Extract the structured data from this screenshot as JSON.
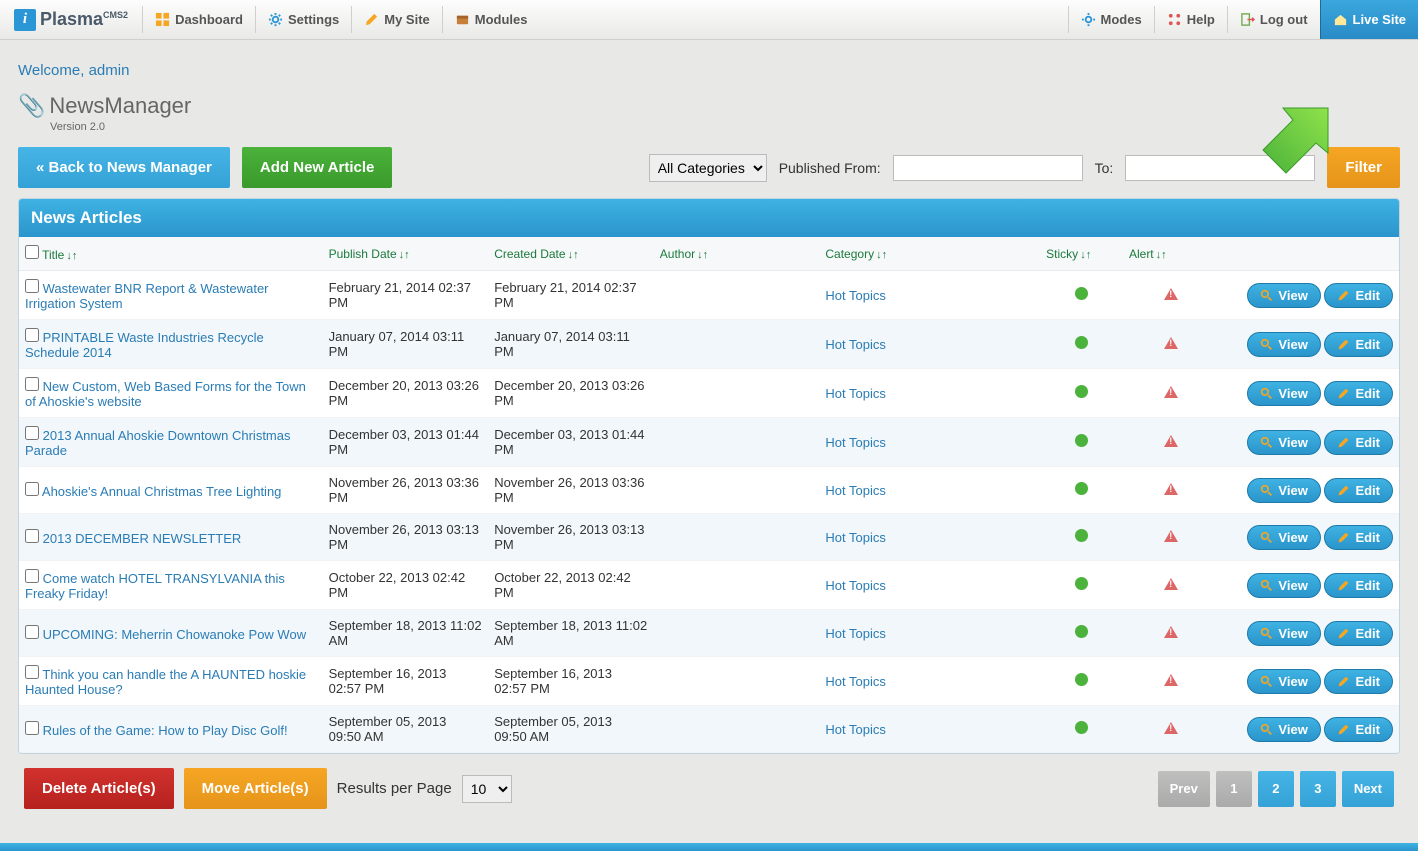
{
  "topnav": {
    "brand_i": "i",
    "brand": "Plasma",
    "brand_suffix": "CMS2",
    "items": [
      "Dashboard",
      "Settings",
      "My Site",
      "Modules"
    ],
    "right": [
      "Modes",
      "Help",
      "Log out",
      "Live Site"
    ]
  },
  "welcome": "Welcome, admin",
  "module": {
    "name": "NewsManager",
    "version": "Version 2.0"
  },
  "buttons": {
    "back": "« Back to News Manager",
    "add": "Add New Article",
    "filter": "Filter",
    "delete": "Delete Article(s)",
    "move": "Move Article(s)"
  },
  "filter": {
    "category_sel": "All Categories",
    "from_lbl": "Published From:",
    "to_lbl": "To:"
  },
  "panel_title": "News Articles",
  "columns": [
    "Title",
    "Publish Date",
    "Created Date",
    "Author",
    "Category",
    "Sticky",
    "Alert"
  ],
  "rows": [
    {
      "title": "Wastewater BNR Report & Wastewater Irrigation System",
      "pub": "February 21, 2014 02:37 PM",
      "crt": "February 21, 2014 02:37 PM",
      "cat": "Hot Topics"
    },
    {
      "title": "PRINTABLE Waste Industries Recycle Schedule 2014",
      "pub": "January 07, 2014 03:11 PM",
      "crt": "January 07, 2014 03:11 PM",
      "cat": "Hot Topics"
    },
    {
      "title": "New Custom, Web Based Forms for the Town of Ahoskie's website",
      "pub": "December 20, 2013 03:26 PM",
      "crt": "December 20, 2013 03:26 PM",
      "cat": "Hot Topics"
    },
    {
      "title": "2013 Annual Ahoskie Downtown Christmas Parade",
      "pub": "December 03, 2013 01:44 PM",
      "crt": "December 03, 2013 01:44 PM",
      "cat": "Hot Topics"
    },
    {
      "title": "Ahoskie's Annual Christmas Tree Lighting",
      "pub": "November 26, 2013 03:36 PM",
      "crt": "November 26, 2013 03:36 PM",
      "cat": "Hot Topics"
    },
    {
      "title": "2013 DECEMBER NEWSLETTER",
      "pub": "November 26, 2013 03:13 PM",
      "crt": "November 26, 2013 03:13 PM",
      "cat": "Hot Topics"
    },
    {
      "title": "Come watch HOTEL TRANSYLVANIA this Freaky Friday!",
      "pub": "October 22, 2013 02:42 PM",
      "crt": "October 22, 2013 02:42 PM",
      "cat": "Hot Topics"
    },
    {
      "title": "UPCOMING: Meherrin Chowanoke Pow Wow",
      "pub": "September 18, 2013 11:02 AM",
      "crt": "September 18, 2013 11:02 AM",
      "cat": "Hot Topics"
    },
    {
      "title": "Think you can handle the A HAUNTED hoskie Haunted House?",
      "pub": "September 16, 2013 02:57 PM",
      "crt": "September 16, 2013 02:57 PM",
      "cat": "Hot Topics"
    },
    {
      "title": "Rules of the Game: How to Play Disc Golf!",
      "pub": "September 05, 2013 09:50 AM",
      "crt": "September 05, 2013 09:50 AM",
      "cat": "Hot Topics"
    }
  ],
  "row_actions": {
    "view": "View",
    "edit": "Edit"
  },
  "rpp_label": "Results per Page",
  "rpp_value": "10",
  "pagination": {
    "prev": "Prev",
    "pages": [
      "1",
      "2",
      "3"
    ],
    "next": "Next"
  }
}
